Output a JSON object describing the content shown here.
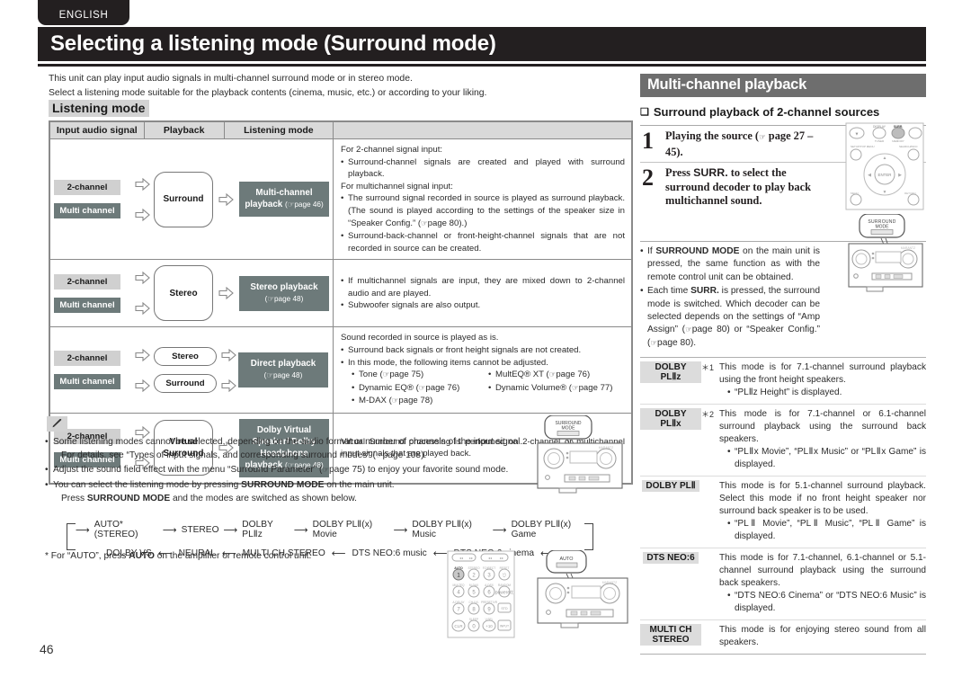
{
  "language_tab": "ENGLISH",
  "page_title": "Selecting a listening mode (Surround mode)",
  "page_number": "46",
  "intro": {
    "line1": "This unit can play input audio signals in multi-channel surround mode or in stereo mode.",
    "line2": "Select a listening mode suitable for the playback contents (cinema, music, etc.) or according to your liking."
  },
  "listening_mode_heading": "Listening mode",
  "table": {
    "headers": {
      "input": "Input audio signal",
      "playback": "Playback",
      "mode": "Listening mode",
      "desc": ""
    },
    "rows": [
      {
        "signals": [
          "2-channel",
          "Multi channel"
        ],
        "processing": [
          "Surround"
        ],
        "mode_label": "Multi-channel playback",
        "mode_page": "page 46",
        "description": {
          "lead1": "For 2-channel signal input:",
          "b1": "Surround-channel signals are created and played with surround playback.",
          "lead2": "For multichannel signal input:",
          "b2": "The surround signal recorded in source is played as surround playback. (The sound is played according to the settings of the speaker size in “Speaker Config.” (",
          "b2_page": "page 80",
          "b2_tail": ").)",
          "b3": "Surround-back-channel or front-height-channel signals that are not recorded in source can be created."
        }
      },
      {
        "signals": [
          "2-channel",
          "Multi channel"
        ],
        "processing": [
          "Stereo"
        ],
        "mode_label": "Stereo playback",
        "mode_page": "page 48",
        "description": {
          "b1": "If multichannel signals are input, they are mixed down to 2-channel audio and are played.",
          "b2": "Subwoofer signals are also output."
        }
      },
      {
        "signals": [
          "2-channel",
          "Multi channel"
        ],
        "processing": [
          "Stereo",
          "Surround"
        ],
        "mode_label": "Direct playback",
        "mode_page": "page 48",
        "description": {
          "lead": "Sound recorded in source is played as is.",
          "b1": "Surround back signals or front height signals are not created.",
          "b2": "In this mode, the following items cannot be adjusted.",
          "items_left": [
            {
              "name": "Tone",
              "page": "page 75"
            },
            {
              "name": "Dynamic EQ®",
              "page": "page 76"
            },
            {
              "name": "M-DAX",
              "page": "page 78"
            }
          ],
          "items_right": [
            {
              "name": "MultEQ® XT",
              "page": "page 76"
            },
            {
              "name": "Dynamic Volume®",
              "page": "page 77"
            }
          ]
        }
      },
      {
        "signals": [
          "2-channel",
          "Multi channel"
        ],
        "processing": [
          "Virtual Surround"
        ],
        "mode_label": "Dolby Virtual Speaker/ Dolby Headphone playback",
        "mode_page": "page 48",
        "description": {
          "b1": "Virtual Surround processing is performed on 2-channel or multichannel input signals that are played back."
        }
      }
    ]
  },
  "notes": {
    "icon": "pencil-icon",
    "items": [
      {
        "text": "Some listening modes cannot be selected, depending on the audio format or number of channels of the input signal.",
        "cont": "For details, see “Types of input signals, and corresponding surround modes” (",
        "page": "page 108",
        "cont_tail": ")."
      },
      {
        "text": "Adjust the sound field effect with the menu “Surround Parameter” (",
        "page": "page 75",
        "cont_tail": ") to enjoy your favorite sound mode."
      },
      {
        "text_a": "You can select the listening mode by pressing ",
        "bold": "SURROUND MODE",
        "text_b": " on the main unit.",
        "cont_a": "Press ",
        "cont_bold": "SURROUND MODE",
        "cont_b": " and the modes are switched as shown below."
      }
    ]
  },
  "loop_diagram": {
    "row1": [
      "AUTO*(STEREO)",
      "STEREO",
      "DOLBY PLⅡz",
      "DOLBY PLⅡ(x) Movie",
      "DOLBY PLⅡ(x) Music",
      "DOLBY PLⅡ(x) Game"
    ],
    "row2": [
      "DOLBY VS",
      "NEURAL",
      "MULTI CH STEREO",
      "DTS NEO:6 music",
      "DTS NEO:6 cinema"
    ]
  },
  "footnote": {
    "star": "*",
    "text_a": " For “AUTO”, press ",
    "bold": "AUTO",
    "text_b": " on the amplifier or remote control unit."
  },
  "right": {
    "title": "Multi-channel playback",
    "subtitle": "Surround playback of 2-channel sources",
    "steps": [
      {
        "num": "1",
        "text": "Playing the source (",
        "page": "page 27 – 45",
        "tail": ")."
      },
      {
        "num": "2",
        "text": "Press SURR. to select the surround decoder to play back multichannel sound."
      }
    ],
    "step2_bold": "SURR.",
    "step2_pre": "Press ",
    "step2_post": " to select the surround decoder to play back multichannel sound.",
    "bullets": [
      {
        "pre": "If ",
        "bold": "SURROUND MODE",
        "post": " on the main unit is pressed, the same function as with the remote control unit can be obtained."
      },
      {
        "pre": "Each time ",
        "bold": "SURR.",
        "post": " is pressed, the surround mode is switched. Which decoder can be selected depends on the settings of “Amp Assign” (",
        "page": "page 80",
        "post2": ") or “Speaker Config.” (",
        "page2": "page 80",
        "post3": ")."
      }
    ],
    "modes": [
      {
        "label": "DOLBY PLⅡz",
        "note": "＊1",
        "body": "This mode is for 7.1-channel surround playback using the front height speakers.",
        "bullets": [
          "“PLⅡz Height” is displayed."
        ]
      },
      {
        "label": "DOLBY PLⅡx",
        "note": "＊2",
        "body": "This mode is for 7.1-channel or 6.1-channel surround playback using the surround back speakers.",
        "bullets": [
          "“PLⅡx Movie”, “PLⅡx Music” or “PLⅡx Game” is displayed."
        ]
      },
      {
        "label": "DOLBY PLⅡ",
        "note": "",
        "body": "This mode is for 5.1-channel surround playback. Select this mode if no front height speaker nor surround back speaker is to be used.",
        "bullets": [
          "“PLⅡ Movie”, “PLⅡ Music”, “PLⅡ Game” is displayed."
        ]
      },
      {
        "label": "DTS NEO:6",
        "note": "",
        "body": "This mode is for 7.1-channel, 6.1-channel or 5.1-channel surround playback using the surround back speakers.",
        "bullets": [
          "“DTS NEO:6 Cinema” or “DTS NEO:6 Music” is displayed."
        ]
      },
      {
        "label": "MULTI CH STEREO",
        "note": "",
        "body": "This mode is for enjoying stereo sound from all speakers.",
        "bullets": []
      }
    ]
  },
  "illustrations": {
    "surround_mode_callout": "SURROUND MODE",
    "auto_callout": "AUTO",
    "remote_keys": [
      "1",
      "2",
      "3",
      "4",
      "5",
      "6",
      "7",
      "8",
      "9",
      "CLR",
      "0",
      "+10"
    ],
    "remote_key_labels": [
      "AUTO",
      "STEREO",
      "F.DIRECT",
      "RESET",
      "MULTEQ",
      "M-DAX",
      "A-DSX",
      "RANDOM",
      "A.DELAY",
      "CH LVL",
      "PRESET/VR",
      "SLEEP",
      "V.SEL"
    ]
  },
  "colors": {
    "title_bar": "#231f20",
    "section_header": "#6e6e6e",
    "mode_box": "#6d7a7a",
    "sig_2channel": "#d0d0d0",
    "sig_multichannel": "#6d7a7a",
    "table_header": "#d9d9d9"
  }
}
